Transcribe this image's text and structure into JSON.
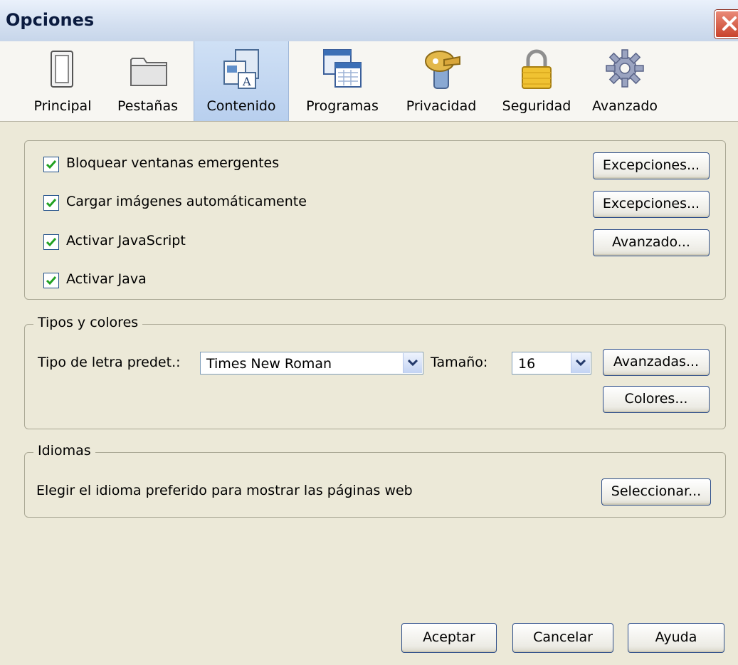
{
  "window": {
    "title": "Opciones"
  },
  "tabs": [
    {
      "label": "Principal",
      "icon": "switch-icon"
    },
    {
      "label": "Pestañas",
      "icon": "tabs-folder-icon"
    },
    {
      "label": "Contenido",
      "icon": "content-icon",
      "selected": true
    },
    {
      "label": "Programas",
      "icon": "applications-icon"
    },
    {
      "label": "Privacidad",
      "icon": "privacy-mask-icon"
    },
    {
      "label": "Seguridad",
      "icon": "padlock-icon"
    },
    {
      "label": "Avanzado",
      "icon": "gear-icon"
    }
  ],
  "content": {
    "checkboxes": [
      {
        "label": "Bloquear ventanas emergentes",
        "checked": true
      },
      {
        "label": "Cargar imágenes automáticamente",
        "checked": true
      },
      {
        "label": "Activar JavaScript",
        "checked": true
      },
      {
        "label": "Activar Java",
        "checked": true
      }
    ],
    "buttons": {
      "exceptions_popups": "Excepciones...",
      "exceptions_images": "Excepciones...",
      "advanced_js": "Avanzado..."
    }
  },
  "fonts": {
    "legend": "Tipos y colores",
    "default_font_label": "Tipo de letra predet.:",
    "default_font_value": "Times New Roman",
    "size_label": "Tamaño:",
    "size_value": "16",
    "advanced_button": "Avanzadas...",
    "colors_button": "Colores..."
  },
  "languages": {
    "legend": "Idiomas",
    "description": "Elegir el idioma preferido para mostrar las páginas web",
    "select_button": "Seleccionar..."
  },
  "footer": {
    "accept": "Aceptar",
    "cancel": "Cancelar",
    "help": "Ayuda"
  },
  "colors": {
    "selected_tab": "#c3d6f1",
    "dialog_bg": "#ece9d8",
    "close_red": "#d8543b"
  }
}
